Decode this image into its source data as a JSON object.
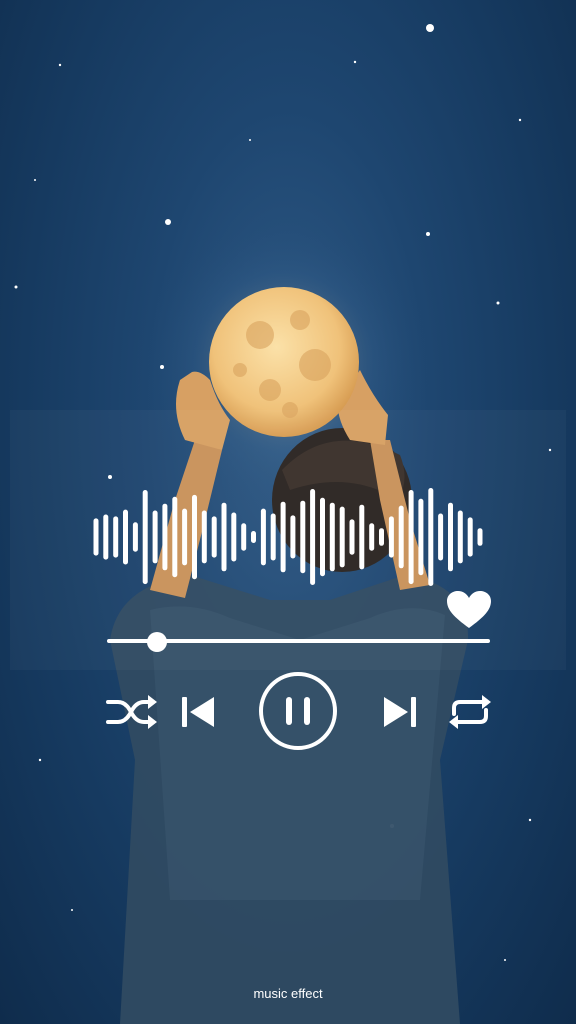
{
  "player": {
    "progress": 0.13,
    "liked": true,
    "state": "playing",
    "accent_color": "#ffffff",
    "waveform_levels": [
      0.38,
      0.46,
      0.42,
      0.56,
      0.3,
      0.96,
      0.54,
      0.68,
      0.82,
      0.58,
      0.86,
      0.54,
      0.42,
      0.7,
      0.5,
      0.28,
      0.12,
      0.58,
      0.48,
      0.72,
      0.44,
      0.74,
      0.98,
      0.8,
      0.7,
      0.62,
      0.36,
      0.66,
      0.28,
      0.18,
      0.42,
      0.64,
      0.96,
      0.78,
      1.0,
      0.48,
      0.7,
      0.54,
      0.4,
      0.18
    ],
    "controls": {
      "shuffle_icon": "shuffle-icon",
      "previous_icon": "skip-previous-icon",
      "play_pause_icon": "pause-icon",
      "next_icon": "skip-next-icon",
      "repeat_icon": "repeat-icon",
      "like_icon": "heart-icon"
    }
  },
  "caption": "music effect"
}
